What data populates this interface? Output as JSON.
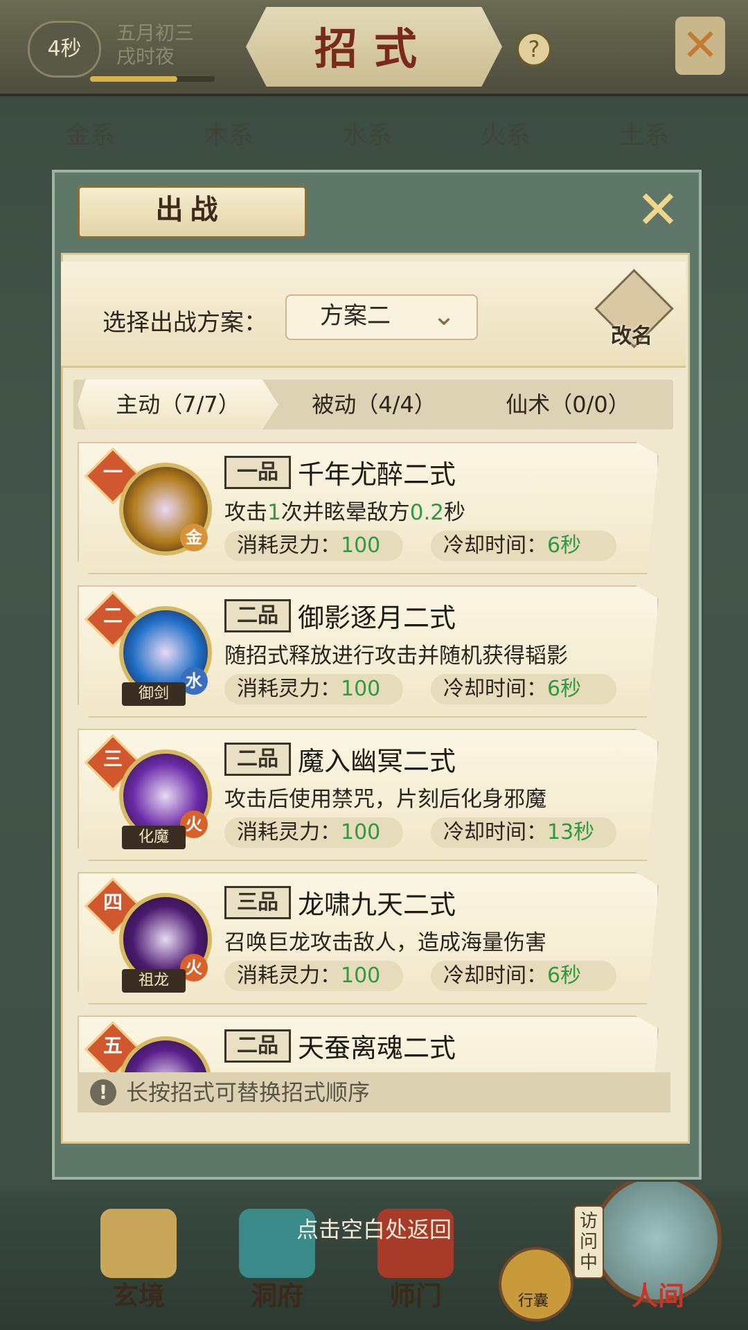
{
  "hud": {
    "timer": "4秒",
    "date_line1": "五月初三",
    "date_line2": "戌时夜",
    "time_progress": 0.7,
    "page_title": "招式",
    "help": "?"
  },
  "element_tabs": [
    "金系",
    "木系",
    "水系",
    "火系",
    "土系"
  ],
  "modal": {
    "title": "出战",
    "plan_label": "选择出战方案：",
    "plan_value": "方案二",
    "rename_label": "改名",
    "subtabs": [
      "主动（7/7）",
      "被动（4/4）",
      "仙术（0/0）"
    ],
    "active_subtab": 0,
    "hint": "长按招式可替换招式顺序"
  },
  "skills": [
    {
      "rank": "一",
      "grade": "一品",
      "name": "千年尤醉二式",
      "desc_parts": [
        "攻击",
        "1",
        "次并眩晕敌方",
        "0.2",
        "秒"
      ],
      "cost_label": "消耗灵力：",
      "cost": "100",
      "cd_label": "冷却时间：",
      "cd": "6秒",
      "element": "金",
      "element_color": "#d8923a",
      "tag": "",
      "portrait_color": "#b07a1a"
    },
    {
      "rank": "二",
      "grade": "二品",
      "name": "御影逐月二式",
      "desc_parts": [
        "随招式释放进行攻击并随机获得韬影",
        "",
        "",
        "",
        ""
      ],
      "cost_label": "消耗灵力：",
      "cost": "100",
      "cd_label": "冷却时间：",
      "cd": "6秒",
      "element": "水",
      "element_color": "#3a6fc0",
      "tag": "御剑",
      "portrait_color": "#1f6fc6"
    },
    {
      "rank": "三",
      "grade": "二品",
      "name": "魔入幽冥二式",
      "desc_parts": [
        "攻击后使用禁咒，片刻后化身邪魔",
        "",
        "",
        "",
        ""
      ],
      "cost_label": "消耗灵力：",
      "cost": "100",
      "cd_label": "冷却时间：",
      "cd": "13秒",
      "element": "火",
      "element_color": "#d8622a",
      "tag": "化魔",
      "portrait_color": "#6a2aa6"
    },
    {
      "rank": "四",
      "grade": "三品",
      "name": "龙啸九天二式",
      "desc_parts": [
        "召唤巨龙攻击敌人，造成海量伤害",
        "",
        "",
        "",
        ""
      ],
      "cost_label": "消耗灵力：",
      "cost": "100",
      "cd_label": "冷却时间：",
      "cd": "6秒",
      "element": "火",
      "element_color": "#d8622a",
      "tag": "祖龙",
      "portrait_color": "#4a1a6e"
    },
    {
      "rank": "五",
      "grade": "二品",
      "name": "天蚕离魂二式",
      "desc_parts": [
        "",
        "",
        "",
        "",
        ""
      ],
      "cost_label": "",
      "cost": "",
      "cd_label": "",
      "cd": "",
      "element": "",
      "element_color": "#d8622a",
      "tag": "",
      "portrait_color": "#5a1f8a"
    }
  ],
  "footer": {
    "return_hint": "点击空白处返回",
    "nav": [
      "玄境",
      "洞府",
      "师门"
    ],
    "bag": "行囊",
    "world": "人间",
    "visit": "访问中"
  },
  "colors": {
    "accent_green": "#2e9a40",
    "rank_red": "#d0572e"
  }
}
